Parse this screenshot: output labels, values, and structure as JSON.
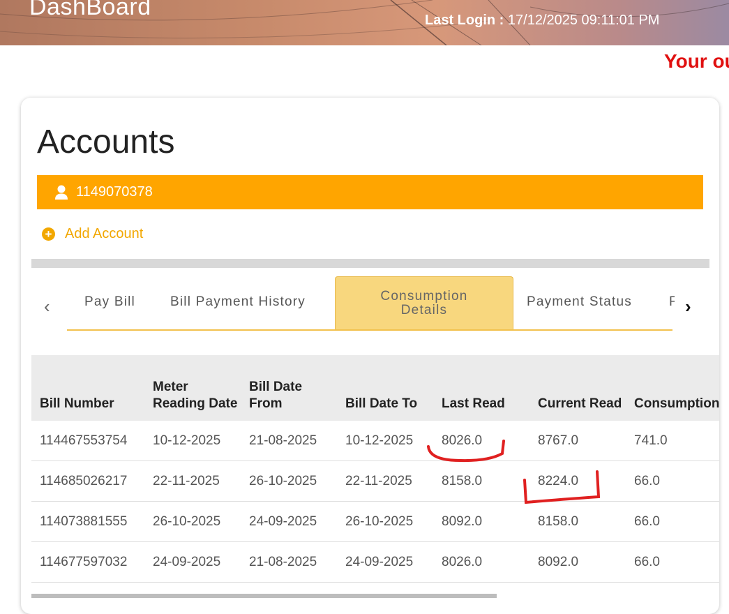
{
  "header": {
    "app_title": "DashBoard",
    "last_login_label": "Last Login :",
    "last_login_value": "17/12/2025 09:11:01 PM"
  },
  "marquee_text": "Your ou",
  "accounts": {
    "title": "Accounts",
    "account_number": "1149070378",
    "add_account_label": "Add Account"
  },
  "tabs": [
    {
      "label": "Pay Bill"
    },
    {
      "label": "Bill Payment History"
    },
    {
      "label": "Consumption Details",
      "active": true
    },
    {
      "label": "Payment Status"
    },
    {
      "label": "F"
    }
  ],
  "table": {
    "headers": [
      "Bill Number",
      "Meter Reading Date",
      "Bill Date From",
      "Bill Date To",
      "Last Read",
      "Current Read",
      "Consumption (KWH)"
    ],
    "rows": [
      [
        "114467553754",
        "10-12-2025",
        "21-08-2025",
        "10-12-2025",
        "8026.0",
        "8767.0",
        "741.0"
      ],
      [
        "114685026217",
        "22-11-2025",
        "26-10-2025",
        "22-11-2025",
        "8158.0",
        "8224.0",
        "66.0"
      ],
      [
        "114073881555",
        "26-10-2025",
        "24-09-2025",
        "26-10-2025",
        "8092.0",
        "8158.0",
        "66.0"
      ],
      [
        "114677597032",
        "24-09-2025",
        "21-08-2025",
        "24-09-2025",
        "8026.0",
        "8092.0",
        "66.0"
      ]
    ]
  },
  "colors": {
    "accent": "#ffa500",
    "active_tab": "#f8d77e",
    "alert": "#e01010",
    "annotation": "#e02020"
  }
}
